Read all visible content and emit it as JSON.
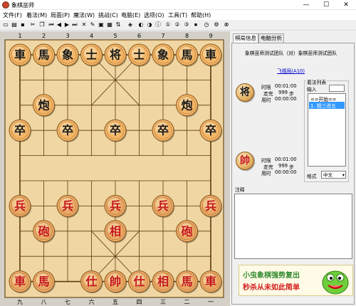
{
  "window": {
    "title": "象棋巫师",
    "minimize": "—",
    "maximize": "☐",
    "close": "✕"
  },
  "menu": [
    "文件(F)",
    "着法(M)",
    "局面(P)",
    "魔法(W)",
    "挑战(C)",
    "电脑(E)",
    "选项(O)",
    "工具(T)",
    "帮助(H)"
  ],
  "toolbar": [
    "new-icon",
    "open-icon",
    "save-icon",
    "cut-icon",
    "copy-icon",
    "first-icon",
    "prev-icon",
    "next-icon",
    "last-icon",
    "delete-icon",
    "edit-icon",
    "save-book-icon",
    "book-icon",
    "flip-icon",
    "analyze-icon",
    "color-icon",
    "color2-icon",
    "info-icon",
    "level1-icon",
    "level2-icon",
    "level3-icon",
    "stop-icon",
    "time-icon",
    "settings-icon",
    "close-icon"
  ],
  "board": {
    "top_labels": [
      "1",
      "2",
      "3",
      "4",
      "5",
      "6",
      "7",
      "8",
      "9"
    ],
    "bottom_labels": [
      "九",
      "八",
      "七",
      "六",
      "五",
      "四",
      "三",
      "二",
      "一"
    ],
    "black_color": "#1a1a1a",
    "red_color": "#c4181e",
    "pieces": [
      {
        "t": "車",
        "c": "black",
        "f": 1,
        "r": 1
      },
      {
        "t": "馬",
        "c": "black",
        "f": 2,
        "r": 1
      },
      {
        "t": "象",
        "c": "black",
        "f": 3,
        "r": 1
      },
      {
        "t": "士",
        "c": "black",
        "f": 4,
        "r": 1
      },
      {
        "t": "将",
        "c": "black",
        "f": 5,
        "r": 1
      },
      {
        "t": "士",
        "c": "black",
        "f": 6,
        "r": 1
      },
      {
        "t": "象",
        "c": "black",
        "f": 7,
        "r": 1
      },
      {
        "t": "馬",
        "c": "black",
        "f": 8,
        "r": 1
      },
      {
        "t": "車",
        "c": "black",
        "f": 9,
        "r": 1
      },
      {
        "t": "炮",
        "c": "black",
        "f": 2,
        "r": 3
      },
      {
        "t": "炮",
        "c": "black",
        "f": 8,
        "r": 3
      },
      {
        "t": "卒",
        "c": "black",
        "f": 1,
        "r": 4
      },
      {
        "t": "卒",
        "c": "black",
        "f": 3,
        "r": 4
      },
      {
        "t": "卒",
        "c": "black",
        "f": 5,
        "r": 4
      },
      {
        "t": "卒",
        "c": "black",
        "f": 7,
        "r": 4
      },
      {
        "t": "卒",
        "c": "black",
        "f": 9,
        "r": 4
      },
      {
        "t": "兵",
        "c": "red",
        "f": 1,
        "r": 7
      },
      {
        "t": "兵",
        "c": "red",
        "f": 3,
        "r": 7
      },
      {
        "t": "兵",
        "c": "red",
        "f": 5,
        "r": 7
      },
      {
        "t": "兵",
        "c": "red",
        "f": 7,
        "r": 7
      },
      {
        "t": "兵",
        "c": "red",
        "f": 9,
        "r": 7
      },
      {
        "t": "砲",
        "c": "red",
        "f": 2,
        "r": 8
      },
      {
        "t": "相",
        "c": "red",
        "f": 5,
        "r": 8
      },
      {
        "t": "砲",
        "c": "red",
        "f": 8,
        "r": 8
      },
      {
        "t": "車",
        "c": "red",
        "f": 1,
        "r": 10
      },
      {
        "t": "馬",
        "c": "red",
        "f": 2,
        "r": 10
      },
      {
        "t": "仕",
        "c": "red",
        "f": 4,
        "r": 10
      },
      {
        "t": "帥",
        "c": "red",
        "f": 5,
        "r": 10
      },
      {
        "t": "仕",
        "c": "red",
        "f": 6,
        "r": 10
      },
      {
        "t": "相",
        "c": "red",
        "f": 7,
        "r": 10
      },
      {
        "t": "馬",
        "c": "red",
        "f": 8,
        "r": 10
      },
      {
        "t": "車",
        "c": "red",
        "f": 9,
        "r": 10
      }
    ]
  },
  "tabs": {
    "active": "棋局信息",
    "other": "电脑分析"
  },
  "panel": {
    "players": "象棋巫师测试团队（对）象棋巫师测试团队",
    "opening": "飞相局(A10)",
    "black": {
      "piece": "将",
      "limit_label": "时限",
      "limit": "00:01:00",
      "moves_label": "走完",
      "moves": "999",
      "moves_unit": "步",
      "used_label": "用时",
      "used": "00:00:00"
    },
    "red": {
      "piece": "帥",
      "limit_label": "时限",
      "limit": "00:01:00",
      "moves_label": "走完",
      "moves": "999",
      "moves_unit": "步",
      "used_label": "用时",
      "used": "00:00:00"
    },
    "movelist_group": "着法列表",
    "input_label": "输入",
    "movelist": [
      "==开始==",
      "1. 相三进五"
    ],
    "format_label": "格式",
    "format_value": "中文",
    "notes_label": "注释"
  },
  "ad": {
    "line1": "小虫象棋强势复出",
    "line2": "秒杀从未如此简单"
  }
}
